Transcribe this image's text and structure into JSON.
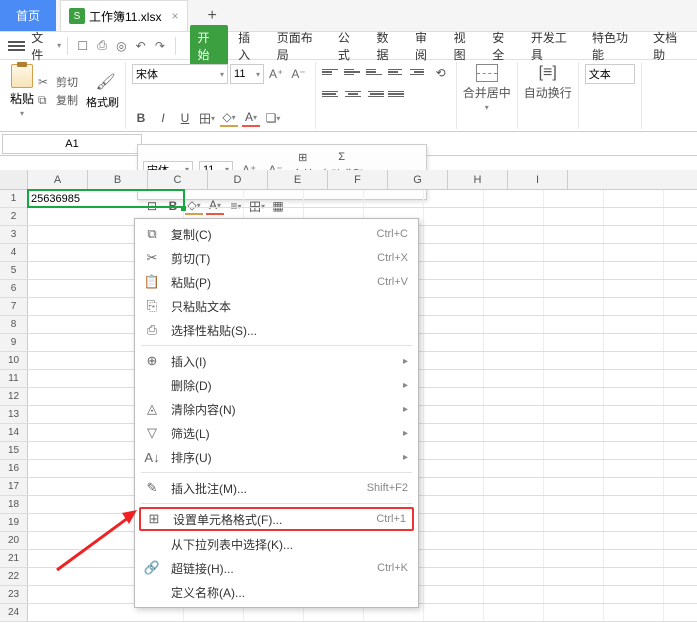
{
  "tabs": {
    "home": "首页",
    "file": "工作簿11.xlsx",
    "new": "+"
  },
  "filemenu": "文件",
  "menu": {
    "start": "开始",
    "insert": "插入",
    "pagelayout": "页面布局",
    "formula": "公式",
    "data": "数据",
    "review": "审阅",
    "view": "视图",
    "security": "安全",
    "dev": "开发工具",
    "special": "特色功能",
    "dochelp": "文档助"
  },
  "clip": {
    "paste": "粘贴",
    "cut": "剪切",
    "copy": "复制",
    "format": "格式刷"
  },
  "font": {
    "family": "宋体",
    "size": "11"
  },
  "merge": {
    "label": "合并居中",
    "wrap": "自动换行"
  },
  "textfmt": "文本",
  "namebox": "A1",
  "float": {
    "merge": "合并",
    "autosum": "自动求和"
  },
  "cols": [
    "A",
    "B",
    "C",
    "D",
    "E",
    "F",
    "G",
    "H",
    "I"
  ],
  "cellA1": "25636985",
  "ctx": {
    "copy": {
      "l": "复制(C)",
      "k": "Ctrl+C"
    },
    "cut": {
      "l": "剪切(T)",
      "k": "Ctrl+X"
    },
    "paste": {
      "l": "粘贴(P)",
      "k": "Ctrl+V"
    },
    "pastetext": {
      "l": "只粘贴文本"
    },
    "pastespecial": {
      "l": "选择性粘贴(S)..."
    },
    "insert": {
      "l": "插入(I)"
    },
    "delete": {
      "l": "删除(D)"
    },
    "clear": {
      "l": "清除内容(N)"
    },
    "filter": {
      "l": "筛选(L)"
    },
    "sort": {
      "l": "排序(U)"
    },
    "comment": {
      "l": "插入批注(M)...",
      "k": "Shift+F2"
    },
    "format": {
      "l": "设置单元格格式(F)...",
      "k": "Ctrl+1"
    },
    "dropdown": {
      "l": "从下拉列表中选择(K)..."
    },
    "hyperlink": {
      "l": "超链接(H)...",
      "k": "Ctrl+K"
    },
    "definename": {
      "l": "定义名称(A)..."
    }
  }
}
